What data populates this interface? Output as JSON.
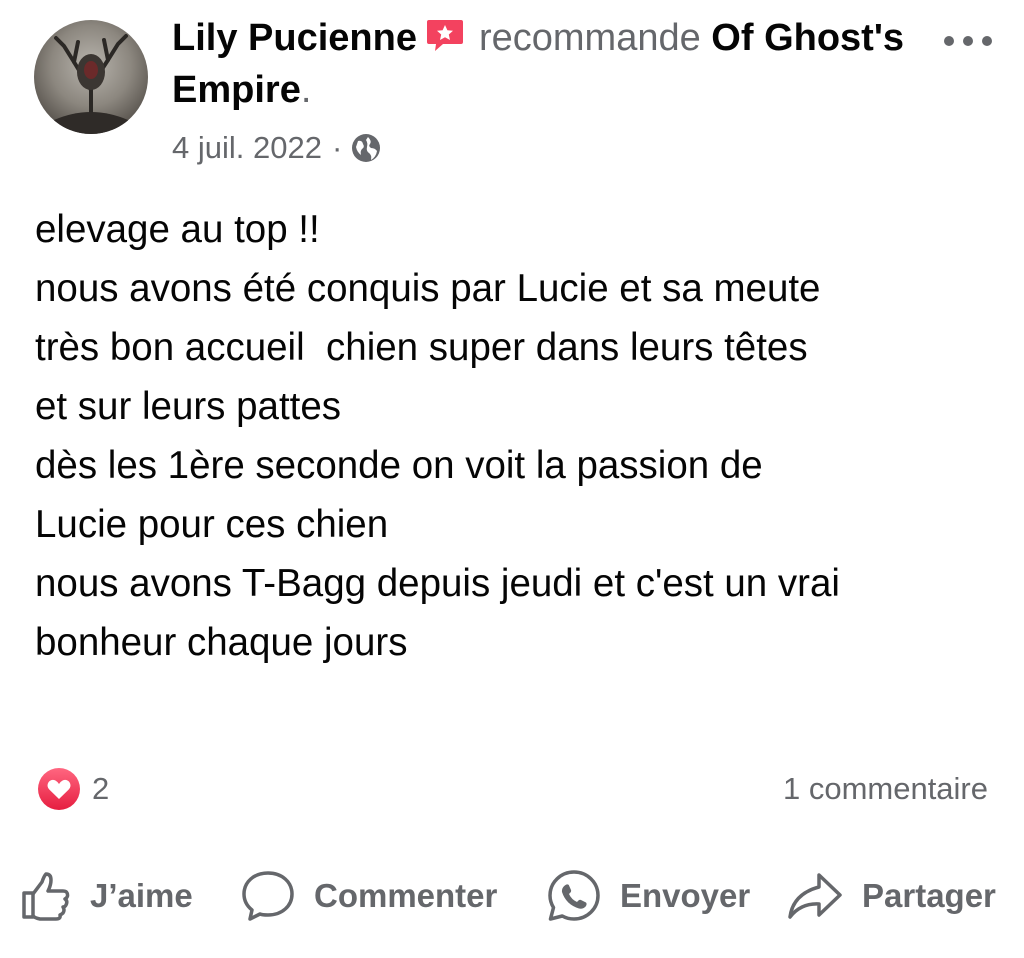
{
  "post": {
    "author": "Lily Pucienne",
    "verb": "recommande",
    "page_name": "Of Ghost's Empire",
    "period": ".",
    "date": "4 juil. 2022",
    "separator": "·",
    "audience_icon": "globe-icon",
    "recommend_icon": "recommend-icon",
    "body_lines": [
      "elevage au top !!",
      "nous avons été conquis par Lucie et sa meute",
      "très bon accueil  chien super dans leurs têtes",
      "et sur leurs pattes",
      "dès les 1ère seconde on voit la passion de",
      "Lucie pour ces chien",
      "nous avons T-Bagg depuis jeudi et c'est un vrai",
      "bonheur chaque jours"
    ]
  },
  "stats": {
    "reaction_icon": "love-icon",
    "reaction_count": "2",
    "comments": "1 commentaire"
  },
  "actions": {
    "like": "J’aime",
    "comment": "Commenter",
    "send": "Envoyer",
    "share": "Partager"
  },
  "colors": {
    "text": "#050505",
    "secondary": "#65676b",
    "recommend_red": "#f3425f",
    "love_red": "#f33e58"
  }
}
